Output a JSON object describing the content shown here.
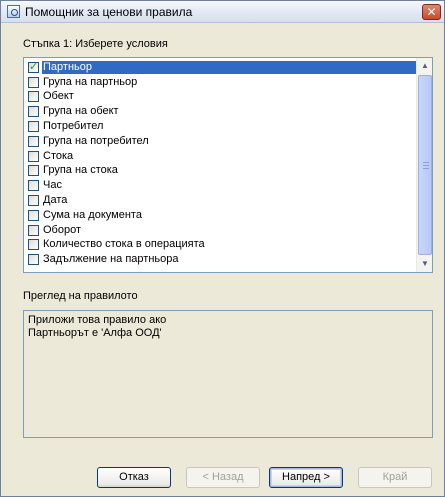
{
  "window": {
    "title": "Помощник за ценови правила",
    "close_label": "✕"
  },
  "step": {
    "label": "Стъпка 1: Изберете условия"
  },
  "conditions": [
    {
      "label": "Партньор",
      "checked": true,
      "selected": true
    },
    {
      "label": "Група на партньор",
      "checked": false,
      "selected": false
    },
    {
      "label": "Обект",
      "checked": false,
      "selected": false
    },
    {
      "label": "Група на обект",
      "checked": false,
      "selected": false
    },
    {
      "label": "Потребител",
      "checked": false,
      "selected": false
    },
    {
      "label": "Група на потребител",
      "checked": false,
      "selected": false
    },
    {
      "label": "Стока",
      "checked": false,
      "selected": false
    },
    {
      "label": "Група на стока",
      "checked": false,
      "selected": false
    },
    {
      "label": "Час",
      "checked": false,
      "selected": false
    },
    {
      "label": "Дата",
      "checked": false,
      "selected": false
    },
    {
      "label": "Сума на документа",
      "checked": false,
      "selected": false
    },
    {
      "label": "Оборот",
      "checked": false,
      "selected": false
    },
    {
      "label": "Количество стока в операцията",
      "checked": false,
      "selected": false
    },
    {
      "label": "Задължение на партньора",
      "checked": false,
      "selected": false
    }
  ],
  "preview": {
    "label": "Преглед на правилото",
    "lines": [
      "Приложи това правило ако",
      "Партньорът  е 'Алфа ООД'"
    ]
  },
  "buttons": {
    "cancel": "Отказ",
    "back": "< Назад",
    "next": "Напред >",
    "finish": "Край"
  },
  "colors": {
    "selection": "#316ac5",
    "dialog_background": "#ece9d8",
    "border": "#7f9db9"
  }
}
